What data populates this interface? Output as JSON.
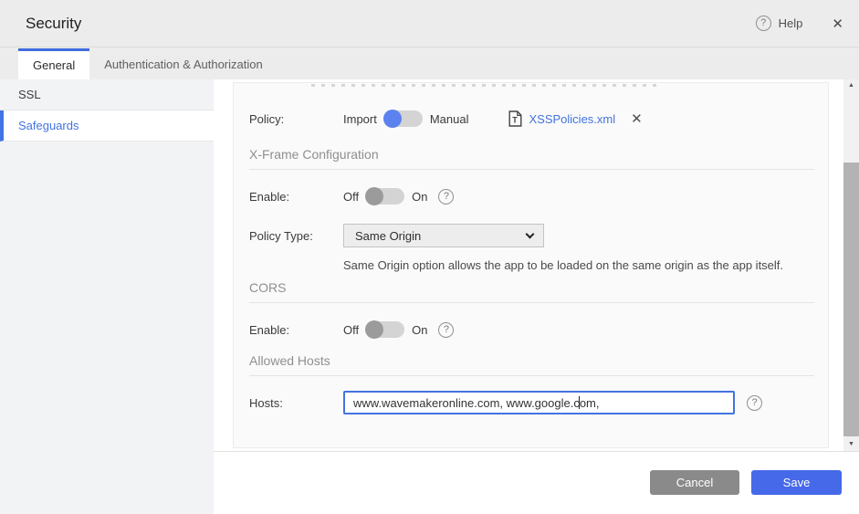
{
  "header": {
    "title": "Security",
    "help_label": "Help"
  },
  "tabs": [
    {
      "label": "General",
      "active": true
    },
    {
      "label": "Authentication & Authorization",
      "active": false
    }
  ],
  "sidebar": {
    "items": [
      {
        "label": "SSL",
        "selected": false
      },
      {
        "label": "Safeguards",
        "selected": true
      }
    ]
  },
  "form": {
    "policy": {
      "label": "Policy:",
      "toggle_left": "Import",
      "toggle_right": "Manual",
      "toggle_state": "Import",
      "file_name": "XSSPolicies.xml"
    },
    "xframe": {
      "section": "X-Frame Configuration",
      "enable_label": "Enable:",
      "off": "Off",
      "on": "On",
      "enable_state": "Off",
      "policy_type_label": "Policy Type:",
      "policy_type_value": "Same Origin",
      "helper": "Same Origin option allows the app to be loaded on the same origin as the app itself."
    },
    "cors": {
      "section": "CORS",
      "enable_label": "Enable:",
      "off": "Off",
      "on": "On",
      "enable_state": "Off"
    },
    "allowed_hosts": {
      "section": "Allowed Hosts",
      "hosts_label": "Hosts:",
      "hosts_value": "www.wavemakeronline.com, www.google.com, "
    }
  },
  "footer": {
    "cancel_label": "Cancel",
    "save_label": "Save"
  },
  "icons": {
    "question": "?",
    "close": "✕",
    "arrow_up": "▲",
    "arrow_down": "▼"
  },
  "colors": {
    "accent": "#4273e1",
    "toggle_on": "#5b82ee",
    "link": "#4272e0",
    "save_button": "#4569e8",
    "cancel_button": "#8a8a8a"
  }
}
